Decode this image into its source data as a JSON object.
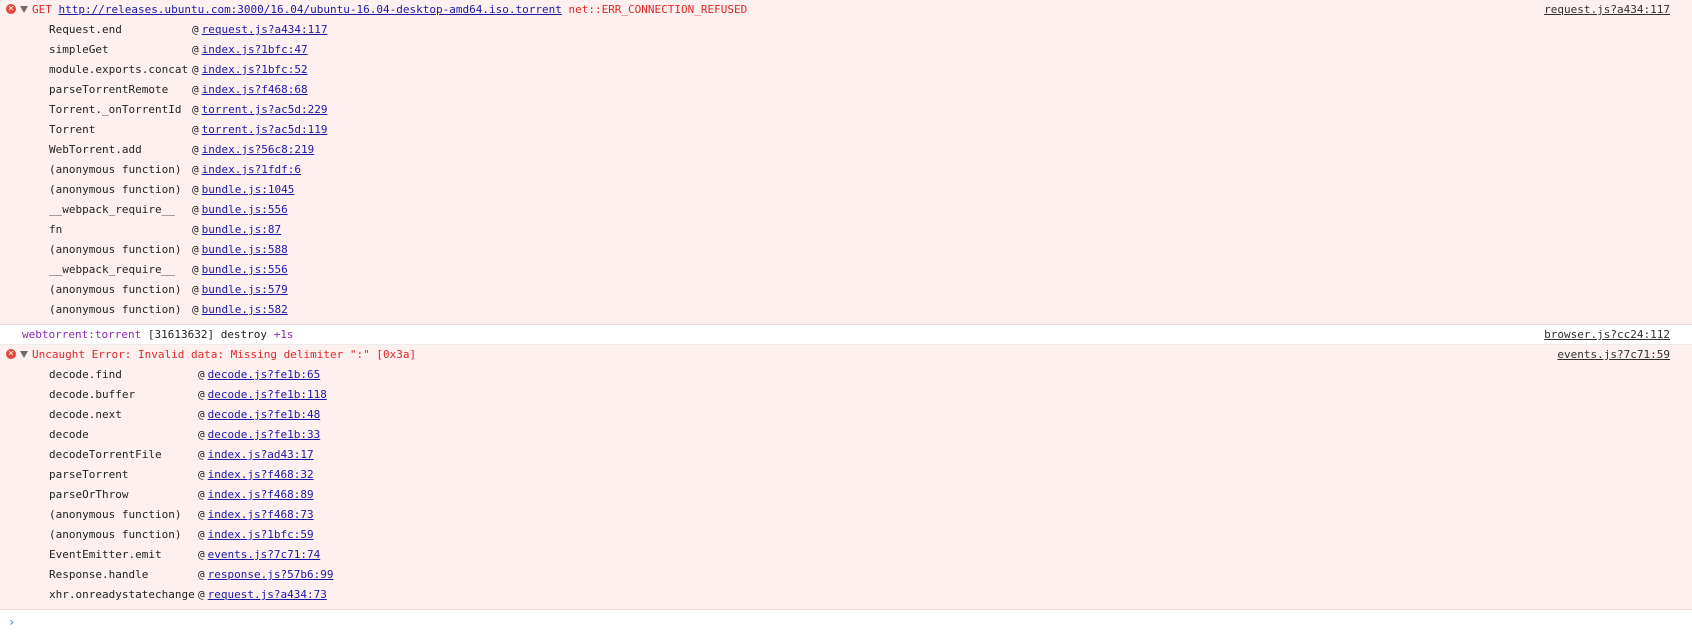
{
  "entries": [
    {
      "kind": "error",
      "method": "GET",
      "url": "http://releases.ubuntu.com:3000/16.04/ubuntu-16.04-desktop-amd64.iso.torrent",
      "message": "net::ERR_CONNECTION_REFUSED",
      "source": "request.js?a434:117",
      "frames": [
        {
          "fn": "Request.end",
          "loc": "request.js?a434:117"
        },
        {
          "fn": "simpleGet",
          "loc": "index.js?1bfc:47"
        },
        {
          "fn": "module.exports.concat",
          "loc": "index.js?1bfc:52"
        },
        {
          "fn": "parseTorrentRemote",
          "loc": "index.js?f468:68"
        },
        {
          "fn": "Torrent._onTorrentId",
          "loc": "torrent.js?ac5d:229"
        },
        {
          "fn": "Torrent",
          "loc": "torrent.js?ac5d:119"
        },
        {
          "fn": "WebTorrent.add",
          "loc": "index.js?56c8:219"
        },
        {
          "fn": "(anonymous function)",
          "loc": "index.js?1fdf:6"
        },
        {
          "fn": "(anonymous function)",
          "loc": "bundle.js:1045"
        },
        {
          "fn": "__webpack_require__",
          "loc": "bundle.js:556"
        },
        {
          "fn": "fn",
          "loc": "bundle.js:87"
        },
        {
          "fn": "(anonymous function)",
          "loc": "bundle.js:588"
        },
        {
          "fn": "__webpack_require__",
          "loc": "bundle.js:556"
        },
        {
          "fn": "(anonymous function)",
          "loc": "bundle.js:579"
        },
        {
          "fn": "(anonymous function)",
          "loc": "bundle.js:582"
        }
      ]
    },
    {
      "kind": "log",
      "namespace": "webtorrent:torrent",
      "message": "[31613632] destroy",
      "diff": "+1s",
      "source": "browser.js?cc24:112"
    },
    {
      "kind": "error",
      "message": "Uncaught Error: Invalid data: Missing delimiter \":\" [0x3a]",
      "source": "events.js?7c71:59",
      "frames": [
        {
          "fn": "decode.find",
          "loc": "decode.js?fe1b:65"
        },
        {
          "fn": "decode.buffer",
          "loc": "decode.js?fe1b:118"
        },
        {
          "fn": "decode.next",
          "loc": "decode.js?fe1b:48"
        },
        {
          "fn": "decode",
          "loc": "decode.js?fe1b:33"
        },
        {
          "fn": "decodeTorrentFile",
          "loc": "index.js?ad43:17"
        },
        {
          "fn": "parseTorrent",
          "loc": "index.js?f468:32"
        },
        {
          "fn": "parseOrThrow",
          "loc": "index.js?f468:89"
        },
        {
          "fn": "(anonymous function)",
          "loc": "index.js?f468:73"
        },
        {
          "fn": "(anonymous function)",
          "loc": "index.js?1bfc:59"
        },
        {
          "fn": "EventEmitter.emit",
          "loc": "events.js?7c71:74"
        },
        {
          "fn": "Response.handle",
          "loc": "response.js?57b6:99"
        },
        {
          "fn": "xhr.onreadystatechange",
          "loc": "request.js?a434:73"
        }
      ]
    }
  ],
  "prompt_symbol": "›",
  "icons": {
    "error": "error-circle-icon",
    "expand": "triangle-down-icon",
    "prompt": "chevron-right-icon"
  }
}
